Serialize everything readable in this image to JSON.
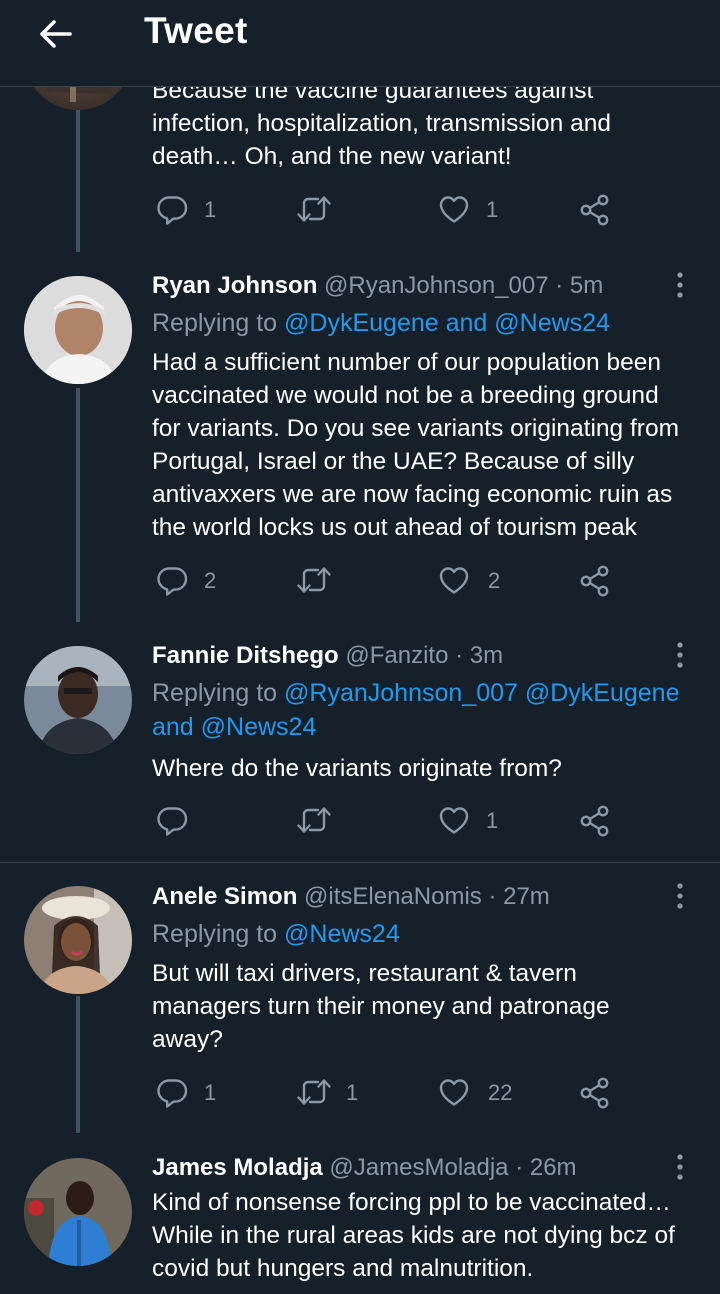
{
  "header": {
    "title": "Tweet",
    "back_icon": "arrow-left-icon"
  },
  "colors": {
    "background": "#15202b",
    "text": "#ffffff",
    "secondary": "#8b98a5",
    "accent": "#1d9bf0",
    "divider": "#38444d"
  },
  "tweets": [
    {
      "lines": [
        "Because the vaccine guarantees against",
        "infection, hospitalization, transmission and",
        "death… Oh, and the new variant!"
      ],
      "actions": {
        "reply": "1",
        "retweet": "",
        "like": "1"
      }
    },
    {
      "name": "Ryan Johnson",
      "handle": "@RyanJohnson_007",
      "time": "· 5m",
      "replying_prefix": "Replying to",
      "replying_lines": [
        "@DykEugene and @News24"
      ],
      "lines": [
        "Had a sufficient number of our population been",
        "vaccinated we would not be a breeding ground",
        "for variants. Do you see variants originating from",
        "Portugal, Israel or the UAE? Because of silly",
        "antivaxxers we are now facing economic ruin as",
        "the world locks us out ahead of tourism peak"
      ],
      "actions": {
        "reply": "2",
        "retweet": "",
        "like": "2"
      }
    },
    {
      "name": "Fannie Ditshego",
      "handle": "@Fanzito",
      "time": "· 3m",
      "replying_prefix": "Replying to",
      "replying_lines": [
        "@RyanJohnson_007 @DykEugene",
        "and @News24"
      ],
      "lines": [
        "Where do the variants originate from?"
      ],
      "actions": {
        "reply": "",
        "retweet": "",
        "like": "1"
      }
    },
    {
      "name": "Anele Simon",
      "handle": "@itsElenaNomis",
      "time": "· 27m",
      "replying_prefix": "Replying to",
      "replying_lines": [
        "@News24"
      ],
      "lines": [
        "But will taxi drivers, restaurant & tavern",
        "managers turn their money and patronage",
        "away?"
      ],
      "actions": {
        "reply": "1",
        "retweet": "1",
        "like": "22"
      }
    },
    {
      "name": "James Moladja",
      "handle": "@JamesMoladja",
      "time": "· 26m",
      "lines": [
        "Kind of nonsense forcing ppl to be vaccinated…",
        "While in the rural areas kids are not dying bcz of",
        "covid but hungers and malnutrition."
      ]
    }
  ]
}
